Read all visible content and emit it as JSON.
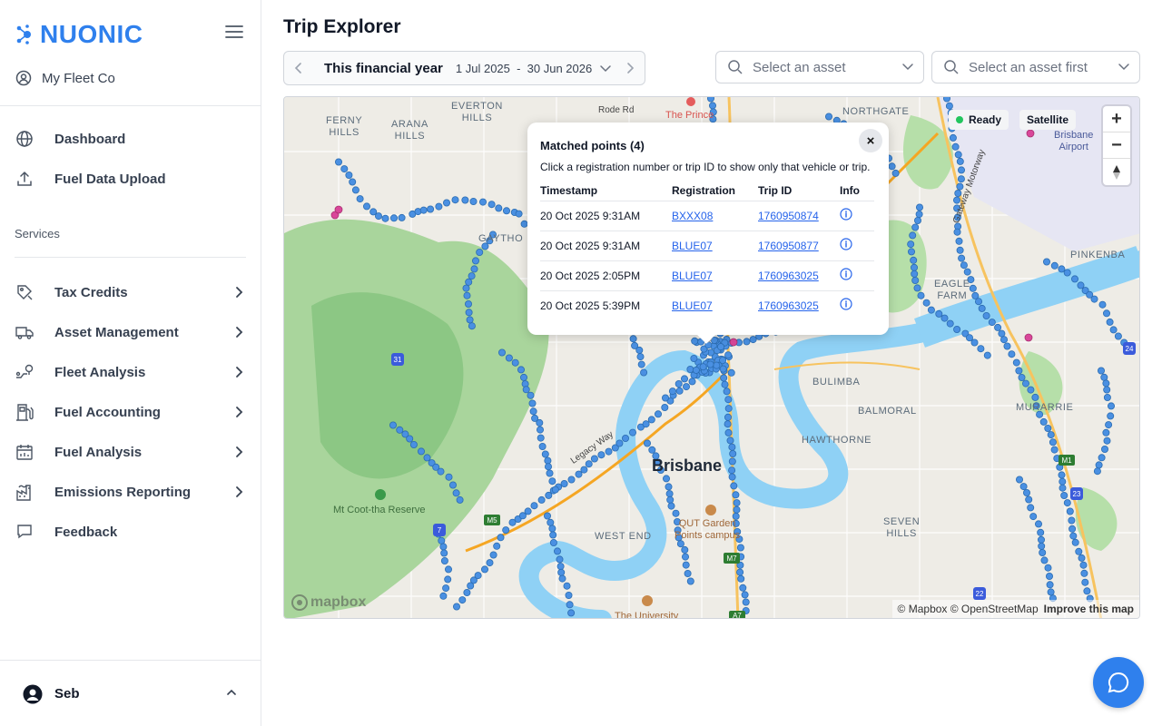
{
  "brand": {
    "name": "NUONIC",
    "color": "#2f80ed"
  },
  "sidebar": {
    "org_name": "My Fleet Co",
    "top_items": [
      {
        "label": "Dashboard",
        "icon": "globe-icon"
      },
      {
        "label": "Fuel Data Upload",
        "icon": "upload-icon"
      }
    ],
    "services_label": "Services",
    "service_items": [
      {
        "label": "Tax Credits",
        "icon": "tax-icon"
      },
      {
        "label": "Asset Management",
        "icon": "truck-icon"
      },
      {
        "label": "Fleet Analysis",
        "icon": "route-icon"
      },
      {
        "label": "Fuel Accounting",
        "icon": "fuel-pump-icon"
      },
      {
        "label": "Fuel Analysis",
        "icon": "calendar-chart-icon"
      },
      {
        "label": "Emissions Reporting",
        "icon": "factory-icon"
      }
    ],
    "feedback_label": "Feedback",
    "user_name": "Seb"
  },
  "page": {
    "title": "Trip Explorer"
  },
  "date_filter": {
    "period": "This financial year",
    "range": "1 Jul 2025  -  30 Jun 2026"
  },
  "asset_select": {
    "placeholder": "Select an asset"
  },
  "trip_select": {
    "placeholder": "Select an asset first"
  },
  "map": {
    "status": "Ready",
    "layer_button": "Satellite",
    "attribution": "© Mapbox © OpenStreetMap",
    "improve_link": "Improve this map",
    "logo": "mapbox",
    "labels": {
      "ferny_hills": "FERNY\nHILLS",
      "arana_hills": "ARANA\nHILLS",
      "everton_hills": "EVERTON\nHILLS",
      "gaythorne": "GAYTHO",
      "northgate": "NORTHGATE",
      "brisbane_airport": "Brisbane\nAirport",
      "pinkenba": "PINKENBA",
      "eagle_farm": "EAGLE\nFARM",
      "bulimba": "BULIMBA",
      "balmoral": "BALMORAL",
      "hawthorne": "HAWTHORNE",
      "murarrie": "MURARRIE",
      "brisbane": "Brisbane",
      "qut": "QUT Garden\nPoints campus",
      "west_end": "WEST END",
      "seven_hills": "SEVEN\nHILLS",
      "mt_cootha": "Mt Coot-tha Reserve",
      "the_university": "The University",
      "the_prince": "The Prince",
      "rode_rd": "Rode Rd",
      "legacy_way": "Legacy Way",
      "gateway_motorway": "Gateway Motorway",
      "shield_31": "31",
      "shield_7": "7",
      "shield_m5": "M5",
      "shield_m7": "M7",
      "shield_m1": "M1",
      "shield_23": "23",
      "shield_22": "22",
      "shield_24": "24",
      "shield_a7": "A7"
    }
  },
  "popup": {
    "title": "Matched points (4)",
    "subtitle": "Click a registration number or trip ID to show only that vehicle or trip.",
    "columns": [
      "Timestamp",
      "Registration",
      "Trip ID",
      "Info"
    ],
    "rows": [
      {
        "timestamp": "20 Oct 2025 9:31AM",
        "registration": "BXXX08",
        "trip_id": "1760950874"
      },
      {
        "timestamp": "20 Oct 2025 9:31AM",
        "registration": "BLUE07",
        "trip_id": "1760950877"
      },
      {
        "timestamp": "20 Oct 2025 2:05PM",
        "registration": "BLUE07",
        "trip_id": "1760963025"
      },
      {
        "timestamp": "20 Oct 2025 5:39PM",
        "registration": "BLUE07",
        "trip_id": "1760963025"
      }
    ]
  },
  "colors": {
    "accent": "#2f80ed",
    "river": "#8fd1f5",
    "park": "#a7d8a0",
    "trip_point": "#4a90e2",
    "status_ready": "#22c55e"
  }
}
